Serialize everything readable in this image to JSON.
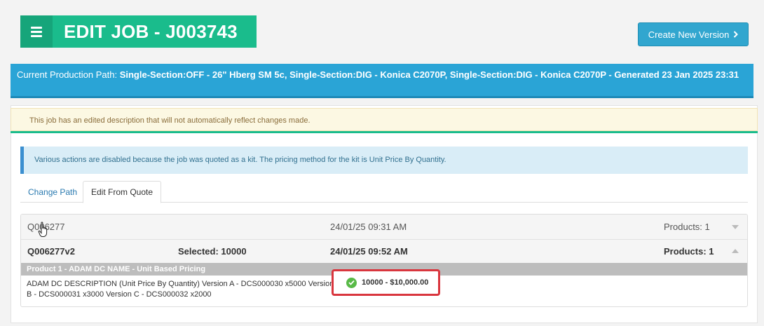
{
  "header": {
    "title": "EDIT JOB - J003743",
    "menu_icon": "hamburger-icon",
    "new_version_label": "Create New Version",
    "new_version_icon": "chevron-right-icon"
  },
  "production_path": {
    "label": "Current Production Path:",
    "value": "Single-Section:OFF - 26\" Hberg SM 5c, Single-Section:DIG - Konica C2070P, Single-Section:DIG - Konica C2070P - Generated 23 Jan 2025 23:31"
  },
  "alerts": {
    "warning": "This job has an edited description that will not automatically reflect changes made.",
    "info": "Various actions are disabled because the job was quoted as a kit. The pricing method for the kit is Unit Price By Quantity."
  },
  "tabs": [
    {
      "label": "Change Path",
      "active": false
    },
    {
      "label": "Edit From Quote",
      "active": true
    }
  ],
  "quotes": [
    {
      "id": "Q006277",
      "selected": "",
      "date": "24/01/25 09:31 AM",
      "products": "Products: 1",
      "expanded": false
    },
    {
      "id": "Q006277v2",
      "selected": "Selected: 10000",
      "date": "24/01/25 09:52 AM",
      "products": "Products: 1",
      "expanded": true
    }
  ],
  "product": {
    "header": "Product 1 - ADAM DC NAME - Unit Based Pricing",
    "description": "ADAM DC DESCRIPTION (Unit Price By Quantity) Version A - DCS000030 x5000 Version B - DCS000031 x3000 Version C - DCS000032 x2000",
    "price_option": "10000 - $10,000.00",
    "price_icon": "check-circle-icon"
  },
  "colors": {
    "accent": "#1abc8c",
    "path_bar": "#2aa4d6",
    "button": "#31a6cf",
    "highlight": "#d9363e"
  }
}
